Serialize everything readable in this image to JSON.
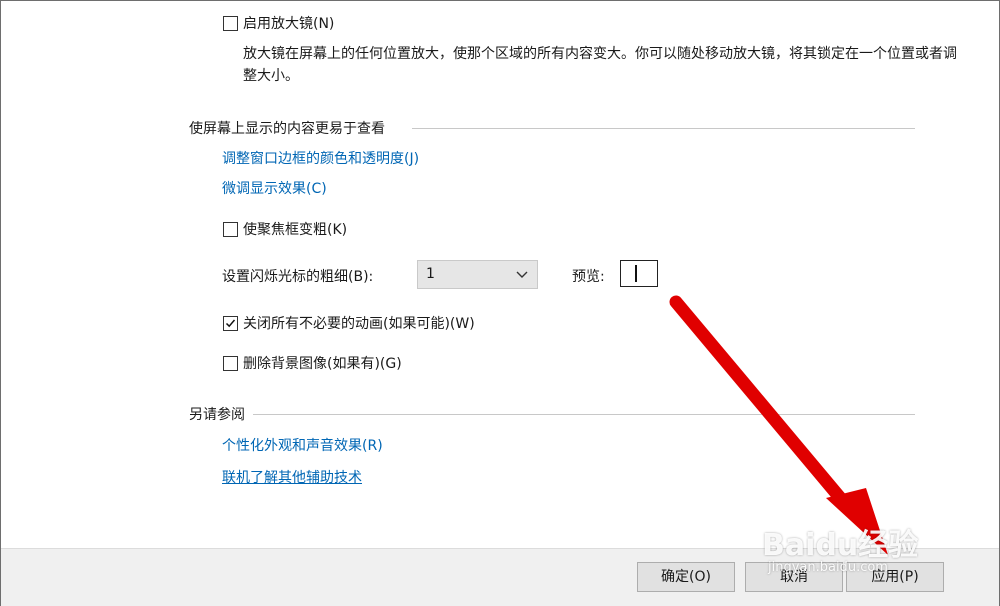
{
  "magnifier": {
    "checkbox_label": "启用放大镜(N)",
    "description": "放大镜在屏幕上的任何位置放大，使那个区域的所有内容变大。你可以随处移动放大镜，将其锁定在一个位置或者调整大小。",
    "checked": false
  },
  "easier_view": {
    "section_title": "使屏幕上显示的内容更易于查看",
    "link_window_border": "调整窗口边框的颜色和透明度(J)",
    "link_display_effects": "微调显示效果(C)",
    "focus_thick_label": "使聚焦框变粗(K)",
    "focus_thick_checked": false,
    "cursor_width_label": "设置闪烁光标的粗细(B):",
    "cursor_width_value": "1",
    "preview_label": "预览:",
    "animations_label": "关闭所有不必要的动画(如果可能)(W)",
    "animations_checked": true,
    "remove_bg_label": "删除背景图像(如果有)(G)",
    "remove_bg_checked": false
  },
  "see_also": {
    "section_title": "另请参阅",
    "link_personalization": "个性化外观和声音效果(R)",
    "link_online": "联机了解其他辅助技术"
  },
  "footer": {
    "ok_label": "确定(O)",
    "cancel_label": "取消",
    "apply_label": "应用(P)"
  },
  "watermark": {
    "brand": "Baidu经验",
    "url": "jingyan.baidu.com"
  },
  "colors": {
    "link": "#0066b4",
    "arrow": "#e00000",
    "footer_bg": "#f0f0f0"
  }
}
